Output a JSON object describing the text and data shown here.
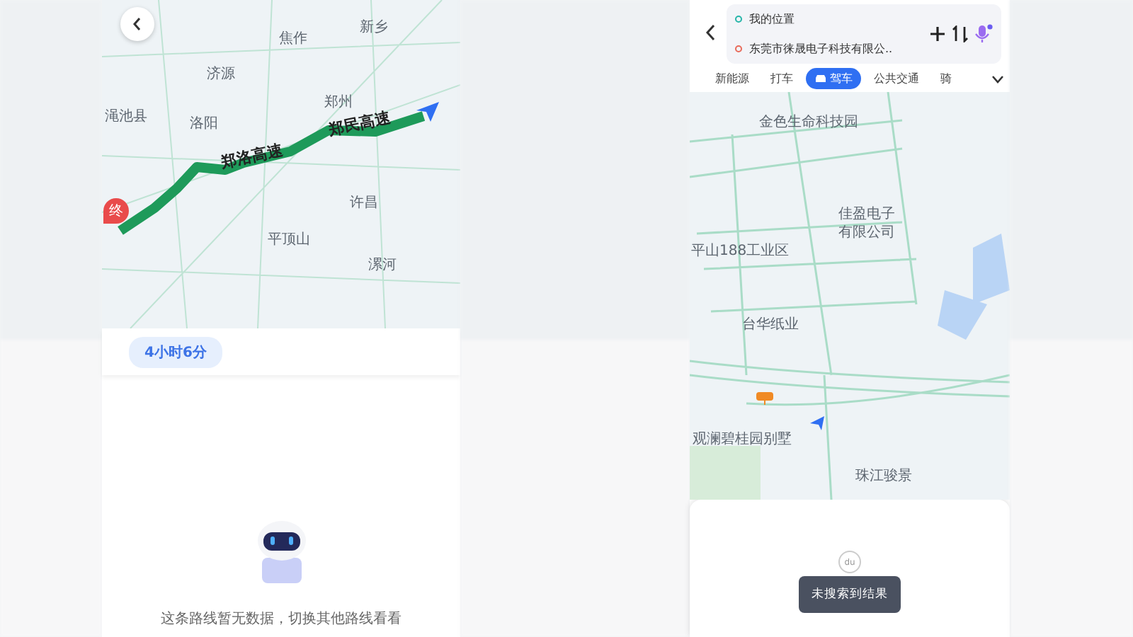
{
  "left_screen": {
    "map_labels": [
      "焦作",
      "新乡",
      "济源",
      "渑池县",
      "洛阳",
      "郑州",
      "许昌",
      "平顶山",
      "漯河"
    ],
    "route_labels": [
      "郑洛高速",
      "郑民高速"
    ],
    "end_marker": "终",
    "duration": "4小时6分",
    "empty_message": "这条路线暂无数据，切换其他路线看看"
  },
  "right_screen": {
    "origin": "我的位置",
    "destination": "东莞市徕晟电子科技有限公..",
    "modes": [
      {
        "label": "新能源",
        "selected": false
      },
      {
        "label": "打车",
        "selected": false
      },
      {
        "label": "驾车",
        "selected": true
      },
      {
        "label": "公共交通",
        "selected": false
      },
      {
        "label": "骑",
        "selected": false
      }
    ],
    "map_labels": [
      "金色生命科技园",
      "佳盈电子有限公司",
      "平山188工业区",
      "台华纸业",
      "观澜碧桂园别墅",
      "珠江骏景"
    ],
    "pin_text": "du",
    "toast": "未搜索到结果"
  }
}
